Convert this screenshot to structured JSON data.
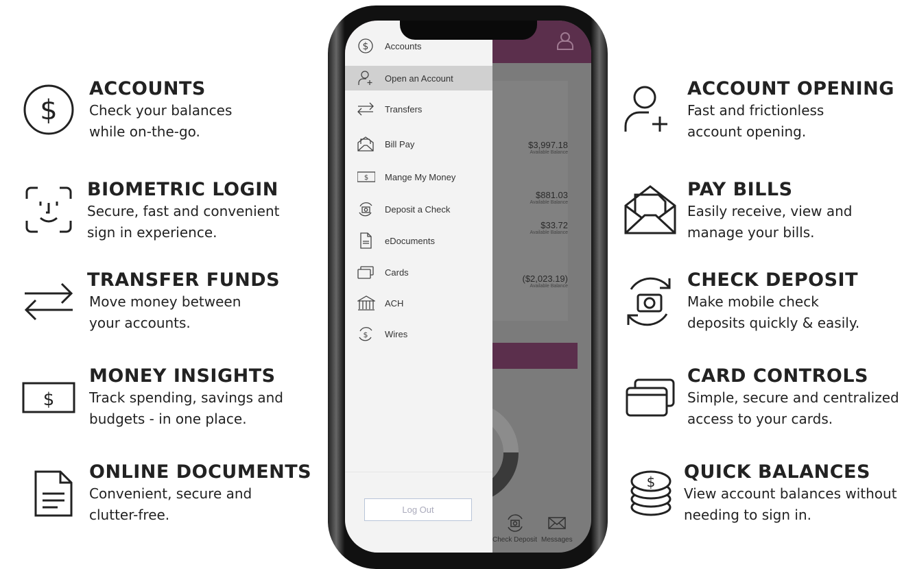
{
  "left_features": [
    {
      "title": "ACCOUNTS",
      "text": [
        "Check your balances",
        "while on-the-go."
      ],
      "icon": "dollar-circle-icon"
    },
    {
      "title": "BIOMETRIC LOGIN",
      "text": [
        "Secure, fast and convenient",
        "sign in experience."
      ],
      "icon": "face-id-icon"
    },
    {
      "title": "TRANSFER FUNDS",
      "text": [
        "Move money between",
        "your accounts."
      ],
      "icon": "transfer-arrows-icon"
    },
    {
      "title": "MONEY INSIGHTS",
      "text": [
        "Track spending, savings and",
        "budgets - in one place."
      ],
      "icon": "dollar-bill-icon"
    },
    {
      "title": "ONLINE DOCUMENTS",
      "text": [
        "Convenient, secure and",
        "clutter-free."
      ],
      "icon": "document-icon"
    }
  ],
  "right_features": [
    {
      "title": "ACCOUNT OPENING",
      "text": [
        "Fast and frictionless",
        "account opening."
      ],
      "icon": "user-plus-icon"
    },
    {
      "title": "PAY BILLS",
      "text": [
        "Easily receive, view and",
        "manage your bills."
      ],
      "icon": "envelope-open-icon"
    },
    {
      "title": "CHECK DEPOSIT",
      "text": [
        "Make mobile check",
        "deposits quickly & easily."
      ],
      "icon": "camera-sync-icon"
    },
    {
      "title": "CARD CONTROLS",
      "text": [
        "Simple, secure and centralized",
        "access to your cards."
      ],
      "icon": "cards-icon"
    },
    {
      "title": "QUICK BALANCES",
      "text": [
        "View account balances without",
        "needing to sign in."
      ],
      "icon": "coin-stack-icon"
    }
  ],
  "phone": {
    "menu": [
      {
        "label": "Accounts",
        "icon": "dollar-circle-icon"
      },
      {
        "label": "Open an Account",
        "icon": "user-plus-icon",
        "selected": true
      },
      {
        "label": "Transfers",
        "icon": "transfer-arrows-icon"
      },
      {
        "label": "Bill Pay",
        "icon": "envelope-open-icon"
      },
      {
        "label": "Mange My Money",
        "icon": "dollar-bill-icon"
      },
      {
        "label": "Deposit a Check",
        "icon": "camera-sync-icon"
      },
      {
        "label": "eDocuments",
        "icon": "document-icon"
      },
      {
        "label": "Cards",
        "icon": "cards-icon"
      },
      {
        "label": "ACH",
        "icon": "bank-icon"
      },
      {
        "label": "Wires",
        "icon": "dollar-sync-icon"
      }
    ],
    "logout": "Log Out",
    "balances": [
      {
        "amount": "$3,997.18",
        "label": "Available Balance"
      },
      {
        "amount": "$881.03",
        "label": "Available Balance"
      },
      {
        "amount": "$33.72",
        "label": "Available Balance"
      },
      {
        "amount": "($2,023.19)",
        "label": "Available Balance"
      }
    ],
    "tabs": [
      "Check Deposit",
      "Messages"
    ],
    "accent": "#5b2f4c"
  }
}
